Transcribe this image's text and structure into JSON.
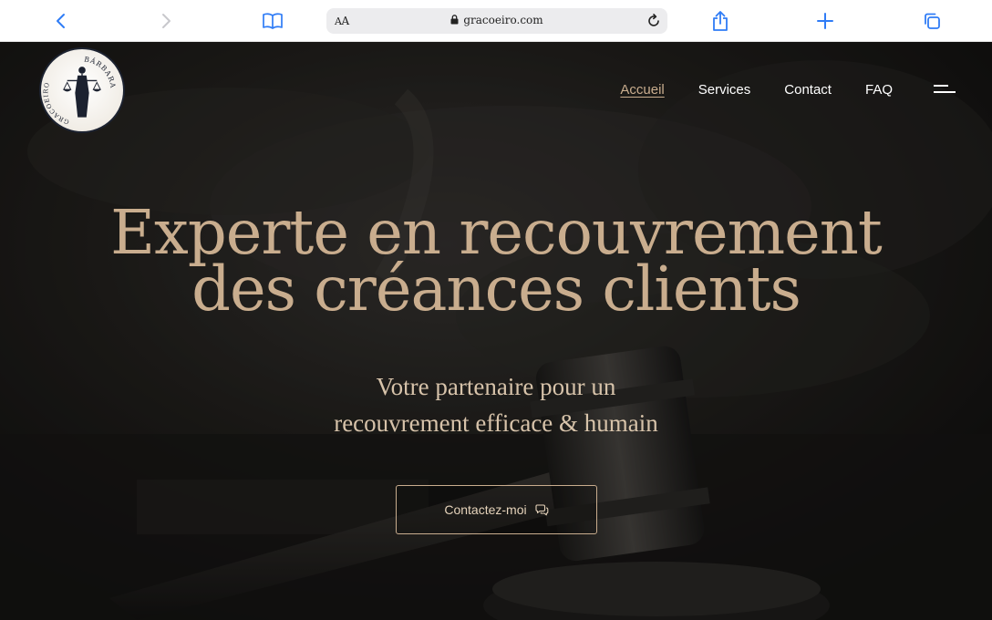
{
  "browser": {
    "reader_label_small": "A",
    "reader_label_big": "A",
    "url": "gracoeiro.com",
    "colors": {
      "icon": "#2f7cf6",
      "icon_disabled": "#c8c8cc"
    },
    "icons": [
      "back-icon",
      "forward-icon",
      "bookmarks-icon",
      "lock-icon",
      "reload-icon",
      "share-icon",
      "new-tab-icon",
      "tabs-icon"
    ]
  },
  "site": {
    "logo": {
      "top_text": "BÁRBARA",
      "side_text": "GRACOEIRO"
    },
    "nav": [
      {
        "label": "Accueil",
        "active": true
      },
      {
        "label": "Services"
      },
      {
        "label": "Contact"
      },
      {
        "label": "FAQ"
      }
    ],
    "hero": {
      "title_line1": "Experte en recouvrement",
      "title_line2": "des créances clients",
      "subtitle_line1": "Votre partenaire pour un",
      "subtitle_line2": "recouvrement efficace & humain",
      "cta_label": "Contactez-moi",
      "cta_icon": "chat-icon"
    },
    "colors": {
      "accent": "#c9ad8e",
      "text": "#ffffff",
      "background": "#151412"
    }
  }
}
